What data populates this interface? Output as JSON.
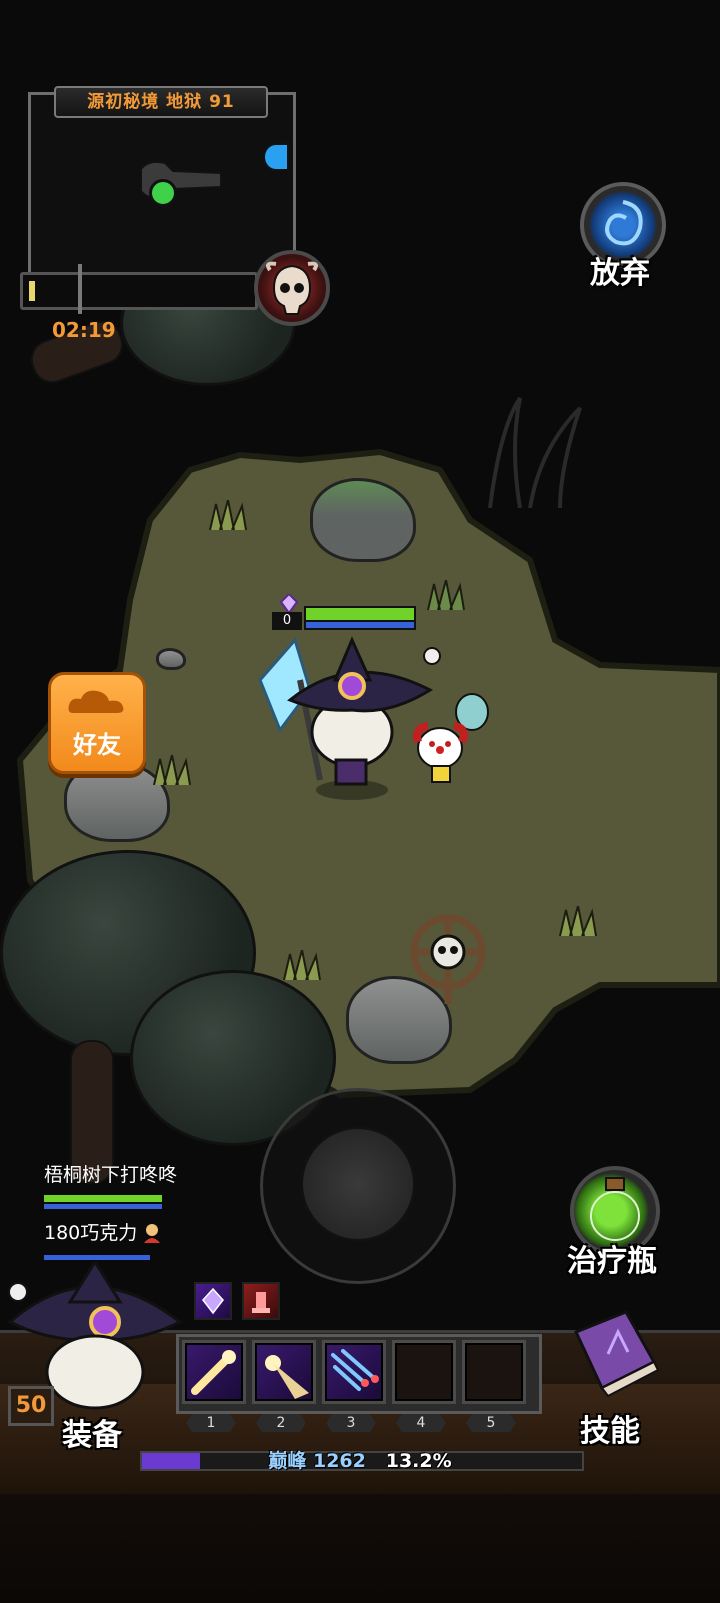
{
  "minimap": {
    "title": "源初秘境 地狱 91",
    "timer": "02:19"
  },
  "buttons": {
    "abandon": "放弃",
    "friends": "好友",
    "potion": "治疗瓶",
    "equip": "装备",
    "skills": "技能"
  },
  "player": {
    "level_tag": "0",
    "character_level": "50"
  },
  "party": [
    {
      "name": "梧桐树下打咚咚"
    },
    {
      "name": "180巧克力"
    }
  ],
  "skill_bar": {
    "slot_numbers": [
      "1",
      "2",
      "3",
      "4",
      "5"
    ],
    "filled_slots": 3
  },
  "xp": {
    "label": "巅峰",
    "level": "1262",
    "percent_text": "13.2%",
    "fraction": 0.132
  },
  "colors": {
    "accent_orange": "#f39a38",
    "hp_green": "#6fd32a",
    "mp_blue": "#3761d6",
    "xp_purple": "#6b3ad1"
  },
  "icons": [
    "boss-skull-icon",
    "portal-icon",
    "cloud-icon",
    "potion-icon",
    "spellbook-icon",
    "crystal-buff-icon",
    "pillar-buff-icon"
  ]
}
